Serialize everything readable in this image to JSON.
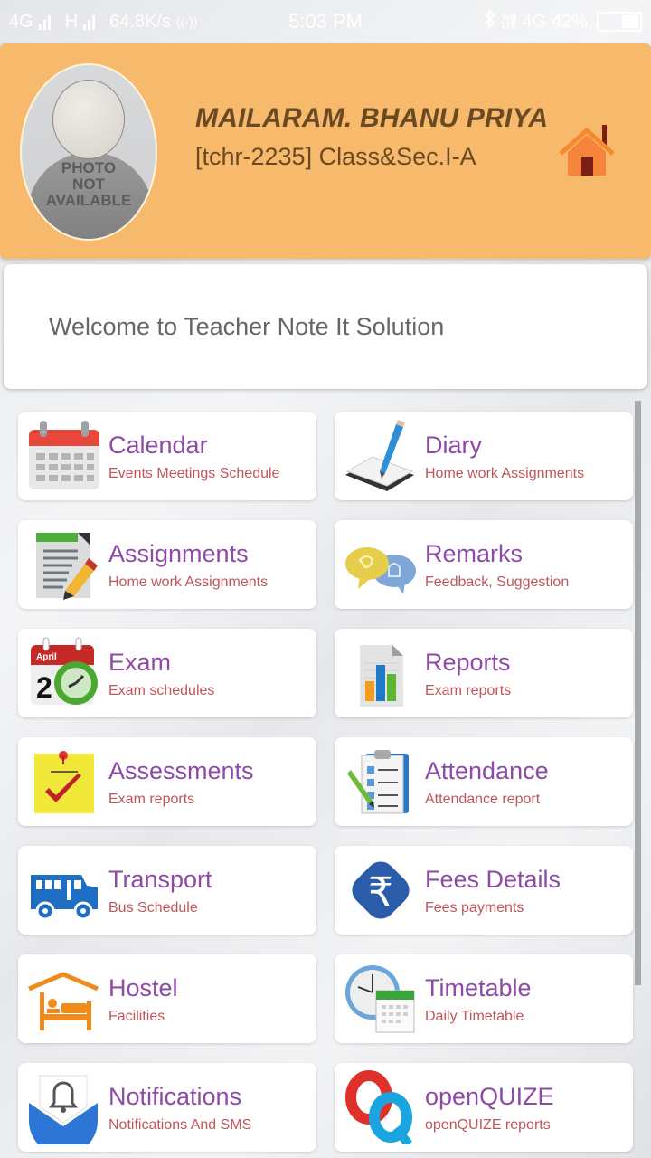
{
  "status_bar": {
    "network1": "4G",
    "network2": "H",
    "speed": "64.8K/s",
    "time": "5:03 PM",
    "volte_top": "Vo))",
    "volte_bottom": "LTE",
    "network3": "4G",
    "battery": "42%"
  },
  "header": {
    "photo_placeholder": [
      "PHOTO",
      "NOT",
      "AVAILABLE"
    ],
    "teacher_name": "MAILARAM. BHANU PRIYA",
    "teacher_id": "[tchr-2235] Class&Sec.I-A",
    "home_icon": "home-icon"
  },
  "welcome": {
    "text": "Welcome to Teacher Note It Solution"
  },
  "menu": [
    {
      "title": "Calendar",
      "subtitle": "Events Meetings Schedule",
      "icon": "calendar-icon"
    },
    {
      "title": "Diary",
      "subtitle": "Home work Assignments",
      "icon": "diary-pencil-icon"
    },
    {
      "title": "Assignments",
      "subtitle": "Home work Assignments",
      "icon": "assignment-document-icon"
    },
    {
      "title": "Remarks",
      "subtitle": "Feedback, Suggestion",
      "icon": "speech-bubbles-icon"
    },
    {
      "title": "Exam",
      "subtitle": "Exam schedules",
      "icon": "exam-calendar-clock-icon"
    },
    {
      "title": "Reports",
      "subtitle": "Exam reports",
      "icon": "bar-report-icon"
    },
    {
      "title": "Assessments",
      "subtitle": "Exam reports",
      "icon": "sticky-note-check-icon"
    },
    {
      "title": "Attendance",
      "subtitle": "Attendance report",
      "icon": "clipboard-icon"
    },
    {
      "title": "Transport",
      "subtitle": "Bus Schedule",
      "icon": "bus-icon"
    },
    {
      "title": "Fees Details",
      "subtitle": "Fees payments",
      "icon": "rupee-icon"
    },
    {
      "title": "Hostel",
      "subtitle": "Facilities",
      "icon": "hostel-bed-icon"
    },
    {
      "title": "Timetable",
      "subtitle": "Daily Timetable",
      "icon": "clock-calendar-icon"
    },
    {
      "title": "Notifications",
      "subtitle": "Notifications And SMS",
      "icon": "notification-bell-icon"
    },
    {
      "title": "openQUIZE",
      "subtitle": "openQUIZE reports",
      "icon": "openquize-logo-icon"
    }
  ],
  "colors": {
    "header_bg": "#f7b96b",
    "title_purple": "#8d4aa6",
    "subtitle_red": "#c0565a",
    "header_text": "#6b4a23"
  }
}
